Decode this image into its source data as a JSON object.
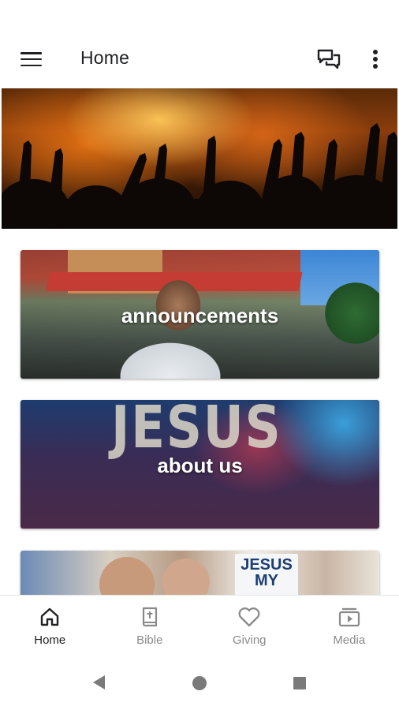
{
  "app_bar": {
    "title": "Home",
    "menu_icon": "hamburger-menu-icon",
    "chat_icon": "chat-bubbles-icon",
    "more_icon": "more-vert-icon"
  },
  "feed": {
    "hero_image": "worship-concert-hands",
    "cards": [
      {
        "label": "announcements",
        "image": "megaphone-street-event"
      },
      {
        "label": "about us",
        "image": "jesus-worship-crowd",
        "image_text": "JESUS"
      },
      {
        "label": "",
        "image": "outreach-people-sign",
        "image_text": "JESUS MY"
      }
    ]
  },
  "bottom_nav": {
    "items": [
      {
        "label": "Home",
        "icon": "home-icon",
        "active": true
      },
      {
        "label": "Bible",
        "icon": "bible-icon",
        "active": false
      },
      {
        "label": "Giving",
        "icon": "heart-icon",
        "active": false
      },
      {
        "label": "Media",
        "icon": "media-play-icon",
        "active": false
      }
    ]
  },
  "colors": {
    "text_primary": "#202124",
    "text_inactive": "#8a8a8a",
    "background": "#ffffff",
    "system_nav_icon": "#7a7a7a"
  }
}
